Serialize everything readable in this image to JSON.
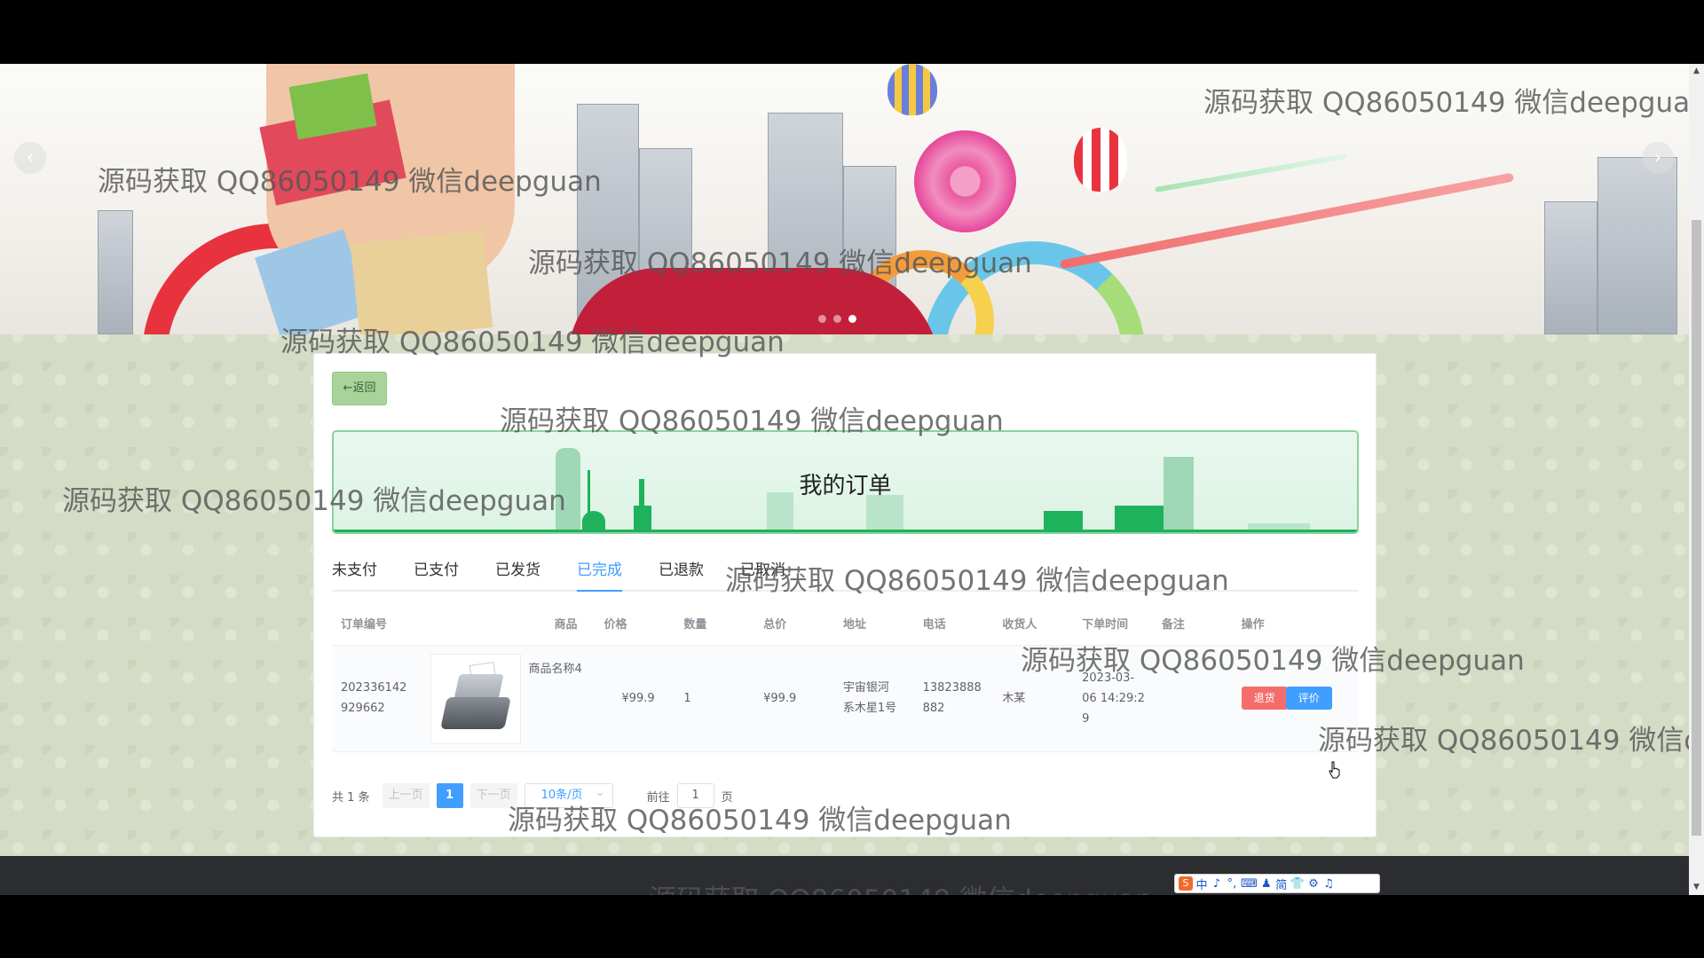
{
  "page": {
    "title": "我的订单"
  },
  "nav": {
    "back_label": "←返回"
  },
  "carousel": {
    "prev_glyph": "‹",
    "next_glyph": "›",
    "dot_count": 3,
    "active_dot": 2
  },
  "tabs": [
    {
      "label": "未支付",
      "active": false
    },
    {
      "label": "已支付",
      "active": false
    },
    {
      "label": "已发货",
      "active": false
    },
    {
      "label": "已完成",
      "active": true
    },
    {
      "label": "已退款",
      "active": false
    },
    {
      "label": "已取消",
      "active": false
    }
  ],
  "table": {
    "headers": [
      "订单编号",
      "商品",
      "价格",
      "数量",
      "总价",
      "地址",
      "电话",
      "收货人",
      "下单时间",
      "备注",
      "操作"
    ],
    "rows": [
      {
        "order_no_line1": "202336142",
        "order_no_line2": "929662",
        "product_name": "商品名称4",
        "price": "¥99.9",
        "quantity": "1",
        "total": "¥99.9",
        "address_line1": "宇宙银河",
        "address_line2": "系木星1号",
        "phone_line1": "13823888",
        "phone_line2": "882",
        "receiver": "木某",
        "time_line1": "2023-03-",
        "time_line2": "06 14:29:2",
        "time_line3": "9",
        "note": "",
        "refund_label": "退货",
        "review_label": "评价"
      }
    ]
  },
  "pagination": {
    "total_label": "共 1 条",
    "prev_label": "上一页",
    "current_page": "1",
    "next_label": "下一页",
    "page_size": "10条/页",
    "goto_label": "前往",
    "goto_value": "1",
    "page_suffix": "页"
  },
  "watermark": "源码获取 QQ86050149 微信deepguan",
  "ime_bar": {
    "items": [
      "中",
      "♪",
      "°,",
      "⌨",
      "♟",
      "简",
      "👕",
      "⚙",
      "♫"
    ]
  },
  "colors": {
    "primary": "#409eff",
    "danger": "#f56c6c",
    "hero_green": "#1fb25d",
    "back_button": "#a8d49b"
  }
}
